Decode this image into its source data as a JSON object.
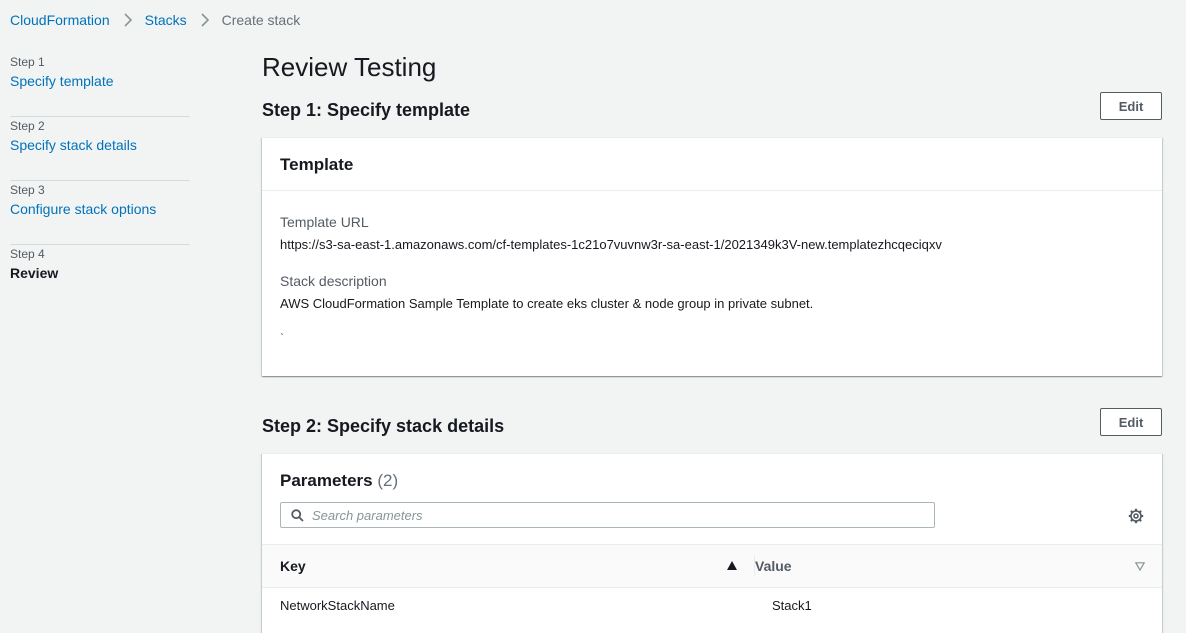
{
  "breadcrumb": {
    "items": [
      {
        "label": "CloudFormation"
      },
      {
        "label": "Stacks"
      },
      {
        "label": "Create stack"
      }
    ]
  },
  "sidenav": {
    "steps": [
      {
        "number": "Step 1",
        "title": "Specify template"
      },
      {
        "number": "Step 2",
        "title": "Specify stack details"
      },
      {
        "number": "Step 3",
        "title": "Configure stack options"
      },
      {
        "number": "Step 4",
        "title": "Review"
      }
    ]
  },
  "page": {
    "title": "Review Testing"
  },
  "step1": {
    "title": "Step 1: Specify template",
    "edit_label": "Edit",
    "panel_title": "Template",
    "template_url_label": "Template URL",
    "template_url_value": "https://s3-sa-east-1.amazonaws.com/cf-templates-1c21o7vuvnw3r-sa-east-1/2021349k3V-new.templatezhcqeciqxv",
    "stack_description_label": "Stack description",
    "stack_description_value": "AWS CloudFormation Sample Template to create eks cluster & node group in private subnet.",
    "tick": "ˋ"
  },
  "step2": {
    "title": "Step 2: Specify stack details",
    "edit_label": "Edit",
    "panel_title": "Parameters",
    "panel_count": "(2)",
    "search_placeholder": "Search parameters",
    "columns": {
      "key": "Key",
      "value": "Value"
    },
    "rows": [
      {
        "key": "NetworkStackName",
        "value": "Stack1"
      }
    ]
  },
  "colors": {
    "link": "#0073bb",
    "text": "#16191f",
    "muted": "#545b64",
    "background": "#f2f3f3"
  },
  "icons": {
    "separator": "chevron-right-icon",
    "search": "search-icon",
    "settings": "gear-icon",
    "sort_asc": "sort-ascending-icon",
    "sort_desc": "sort-descending-icon"
  }
}
